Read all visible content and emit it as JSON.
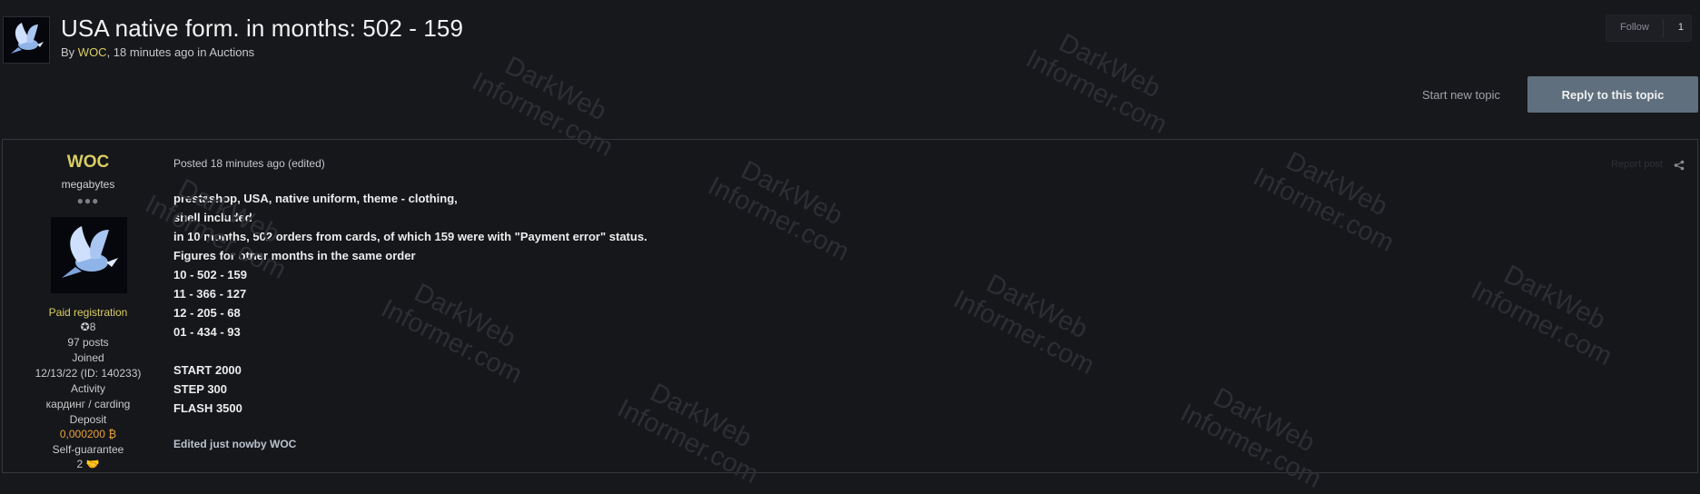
{
  "header": {
    "title": "USA native form. in months: 502 - 159",
    "meta_prefix": "By",
    "author": "WOC",
    "meta_suffix": ", 18 minutes ago in Auctions",
    "follow_label": "Follow",
    "follow_count": "1",
    "start_topic": "Start new topic",
    "reply": "Reply to this topic"
  },
  "author_card": {
    "name": "WOC",
    "group": "megabytes",
    "reputation_dots": "●●●",
    "paid": "Paid registration",
    "badge": "8",
    "posts": "97 posts",
    "joined_label": "Joined",
    "joined_value": "12/13/22 (ID: 140233)",
    "activity_label": "Activity",
    "activity_value": "кардинг / carding",
    "deposit_label": "Deposit",
    "deposit_value": "0,000200",
    "self_guarantee_label": "Self-guarantee",
    "self_guarantee_value": "2"
  },
  "post": {
    "posted": "Posted 18 minutes ago (edited)",
    "report": "Report post",
    "lines": [
      "prestashop, USA, native uniform, theme - clothing,",
      "shell included",
      "in 10 months, 502 orders from cards, of which 159 were with \"Payment error\" status.",
      "Figures for other months in the same order",
      "10 - 502 - 159",
      "11 - 366 - 127",
      "12 - 205 - 68",
      "01 - 434 - 93",
      "START 2000",
      "STEP 300",
      "FLASH 3500"
    ],
    "edited": "Edited just nowby WOC"
  },
  "watermark": {
    "line1": "DarkWeb",
    "line2": "Informer.com"
  },
  "colors": {
    "background": "#17181c",
    "accent_yellow": "#d9cd63",
    "reply_button": "#5f6f7e",
    "deposit_orange": "#e8a23a"
  }
}
